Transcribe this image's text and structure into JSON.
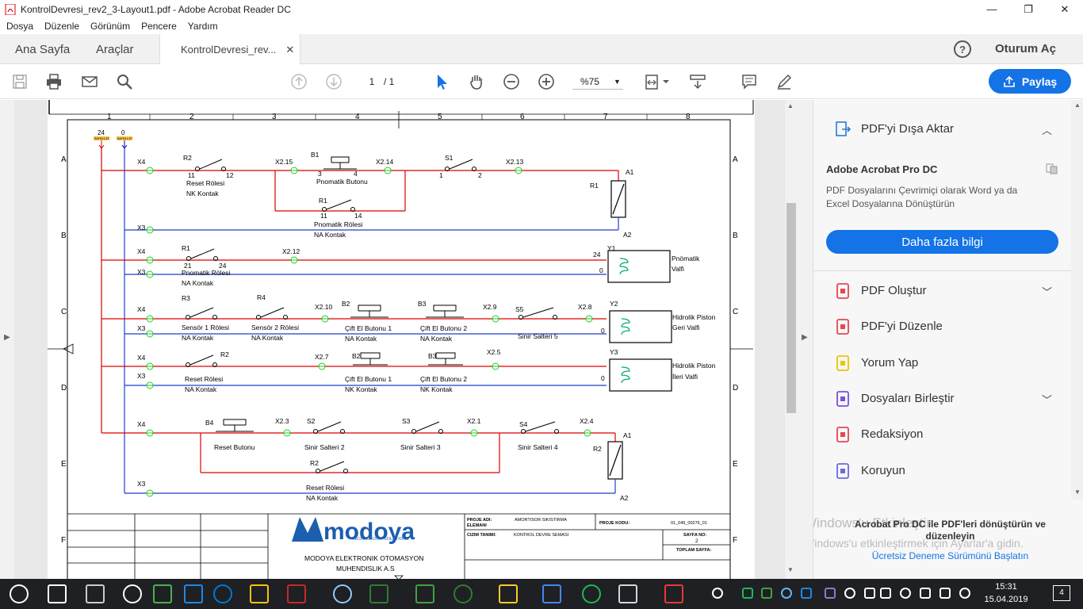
{
  "window": {
    "title": "KontrolDevresi_rev2_3-Layout1.pdf - Adobe Acrobat Reader DC",
    "minimize": "—",
    "maximize": "❐",
    "close": "✕"
  },
  "menu": [
    "Dosya",
    "Düzenle",
    "Görünüm",
    "Pencere",
    "Yardım"
  ],
  "tabs": {
    "home": "Ana Sayfa",
    "tools": "Araçlar",
    "document": "KontrolDevresi_rev...",
    "close": "✕"
  },
  "header": {
    "help": "?",
    "login": "Oturum Aç"
  },
  "toolbar": {
    "page_current": "1",
    "page_total": "/ 1",
    "zoom": "%75",
    "share": "Paylaş"
  },
  "sidebar": {
    "export_title": "PDF'yi Dışa Aktar",
    "pro_title": "Adobe Acrobat Pro DC",
    "pro_desc": "PDF Dosyalarını Çevrimiçi olarak Word ya da Excel Dosyalarına Dönüştürün",
    "more_button": "Daha fazla bilgi",
    "items": [
      {
        "label": "PDF Oluştur",
        "icon": "create-pdf-icon",
        "color": "#e34850",
        "chevron": true
      },
      {
        "label": "PDF'yi Düzenle",
        "icon": "edit-pdf-icon",
        "color": "#e34850",
        "chevron": false
      },
      {
        "label": "Yorum Yap",
        "icon": "comment-icon",
        "color": "#e8c600",
        "chevron": false
      },
      {
        "label": "Dosyaları Birleştir",
        "icon": "combine-files-icon",
        "color": "#7a4fe0",
        "chevron": true
      },
      {
        "label": "Redaksiyon",
        "icon": "redact-icon",
        "color": "#e34850",
        "chevron": false
      },
      {
        "label": "Koruyun",
        "icon": "protect-icon",
        "color": "#6b68e6",
        "chevron": false
      }
    ],
    "footer_title": "Acrobat Pro DC ile PDF'leri dönüştürün ve düzenleyin",
    "footer_link": "Ücretsiz Deneme Sürümünü Başlatın",
    "watermark_line1": "Windows'u Etkinleştir",
    "watermark_line2": "Windows'u etkinleştirmek için Ayarlar'a gidin."
  },
  "drawing": {
    "columns": [
      "1",
      "2",
      "3",
      "4",
      "5",
      "6",
      "7",
      "8"
    ],
    "rows": [
      "A",
      "B",
      "C",
      "D",
      "E",
      "F"
    ],
    "top_labels": {
      "v24": "24",
      "v0": "0",
      "ref": "SAYFA 1,E7"
    },
    "labels": [
      "X4",
      "R2",
      "11",
      "12",
      "Reset Rölesi",
      "NK Kontak",
      "X2.15",
      "B1",
      "3",
      "4",
      "Pnomatik Butonu",
      "X2.14",
      "S1",
      "1",
      "2",
      "X2.13",
      "A1",
      "R1",
      "R1",
      "11",
      "14",
      "Pnomatik Rölesi",
      "NA Kontak",
      "X3",
      "A2",
      "X4",
      "R1",
      "21",
      "24",
      "Pnomatik Rölesi",
      "NA Kontak",
      "X2.12",
      "24",
      "Y1",
      "Pnömatik",
      "Valfi",
      "X3",
      "0",
      "X4",
      "R3",
      "R4",
      "X2.10",
      "B2",
      "B3",
      "X2.9",
      "S5",
      "X2.8",
      "Y2",
      "Hidrolik Piston",
      "Geri Valfi",
      "X3",
      "Sensör 1 Rölesi",
      "Sensör 2 Rölesi",
      "Çift El Butonu 1",
      "Çift El Butonu 2",
      "Sinir Salteri 5",
      "NA Kontak",
      "NA Kontak",
      "NA Kontak",
      "NA Kontak",
      "0",
      "X4",
      "R2",
      "X2.7",
      "B2",
      "B3",
      "X2.5",
      "Y3",
      "Hidrolik Piston",
      "İleri Valfi",
      "X3",
      "Reset Rölesi",
      "Çift El Butonu 1",
      "Çift El Butonu 2",
      "NA Kontak",
      "NK Kontak",
      "NK Kontak",
      "0",
      "X4",
      "B4",
      "X2.3",
      "S2",
      "S3",
      "X2.1",
      "S4",
      "X2.4",
      "A1",
      "R2",
      "Reset Butonu",
      "Sinir Salteri 2",
      "Sinir Salteri 3",
      "Sinir Salteri 4",
      "R2",
      "Reset Rölesi",
      "NA Kontak",
      "X3",
      "A2"
    ],
    "titleblock": {
      "company": "MODOYA ELEKTRONIK OTOMASYON",
      "company2": "MUHENDISLIK A.S",
      "logo": "modoya",
      "logo_sub": "TECHNOLOGY SOLUTIONS",
      "proje_adi_label": "PROJE ADI:",
      "eleman_label": "ELEMANI",
      "proje_adi": "AMORTISOR SIKISTIRMA",
      "proje_kodu_label": "PROJE KODU:",
      "proje_kodu": "01_049_00276_01",
      "cizim_tanimi_label": "CIZIM TANIMI:",
      "cizim_tanimi": "KONTROL DEVRE SEMASI",
      "sayfa_no_label": "SAYFA NO:",
      "sayfa_no": "2",
      "toplam_sayfa_label": "TOPLAM SAYFA:"
    }
  },
  "taskbar": {
    "time": "15:31",
    "date": "15.04.2019",
    "notifications": "4"
  }
}
